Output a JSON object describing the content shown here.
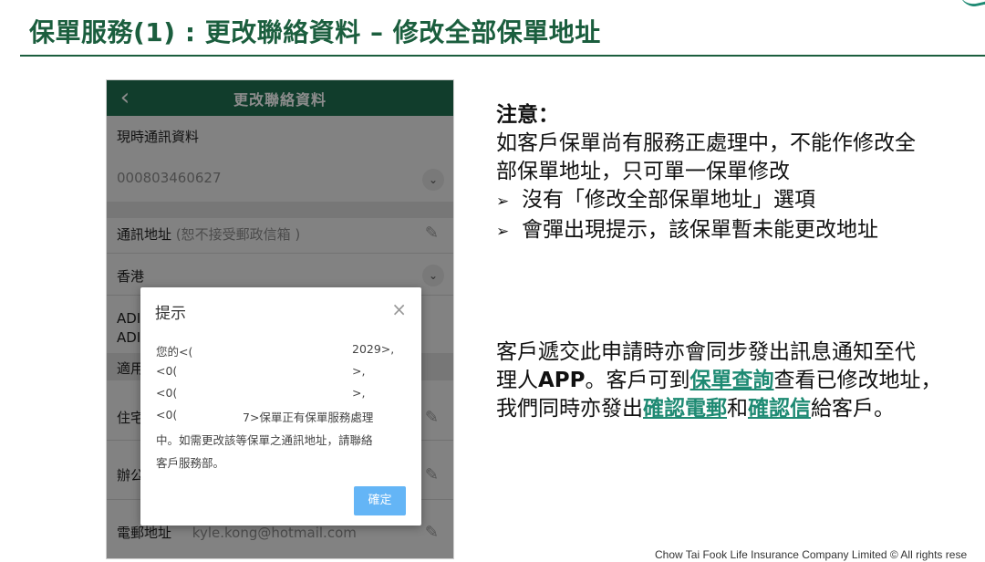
{
  "slide": {
    "title": "保單服務(1) : 更改聯絡資料 – 修改全部保單地址",
    "footer": "Chow Tai Fook Life Insurance Company Limited © All rights rese"
  },
  "app": {
    "header_title": "更改聯絡資料",
    "back_icon": "‹",
    "current_contact_label": "現時通訊資料",
    "current_contact_value": "000803460627",
    "mailing_address_label": "通訊地址",
    "mailing_address_note": " (恕不接受郵政信箱 )",
    "region_value": "香港",
    "address_line1": "ADI",
    "address_line2": "ADI",
    "applicable_label": "適用",
    "residential_label": "住宅",
    "office_label": "辦公",
    "email_label": "電郵地址",
    "email_value": "kyle.kong@hotmail.com"
  },
  "dialog": {
    "title": "提示",
    "close_icon": "×",
    "line1_left": "您的<(",
    "line1_right": "2029>,",
    "line2_left": "<0(",
    "line2_right": ">,",
    "line3_left": "<0(",
    "line3_right": ">,",
    "line4_left": "<0(",
    "line4_right": "7>保單正有保單服務處理",
    "line5": "中。如需更改該等保單之通訊地址，請聯絡",
    "line6": "客戶服務部。",
    "confirm": "確定"
  },
  "notes": {
    "heading": "注意：",
    "line1": "如客戶保單尚有服務正處理中，不能作修改全",
    "line2": "部保單地址，只可單一保單修改",
    "bullet_icon": "➢",
    "bullet1": "沒有「修改全部保單地址」選項",
    "bullet2": "會彈出現提示，該保單暫未能更改地址"
  },
  "notes2": {
    "line1": "客戶遞交此申請時亦會同步發出訊息通知至代",
    "line2_a": "理人",
    "line2_app": "APP",
    "line2_b": "。客戶可到",
    "line2_link": "保單查詢",
    "line2_c": "查看已修改地址，",
    "line3_a": "我們同時亦發出",
    "line3_link1": "確認電郵",
    "line3_b": "和",
    "line3_link2": "確認信",
    "line3_c": "給客戶。"
  },
  "colors": {
    "brand_green": "#1f6f50",
    "title_green": "#1b5e3e",
    "link_teal": "#1e8a73",
    "confirm_blue": "#64b5f6"
  }
}
